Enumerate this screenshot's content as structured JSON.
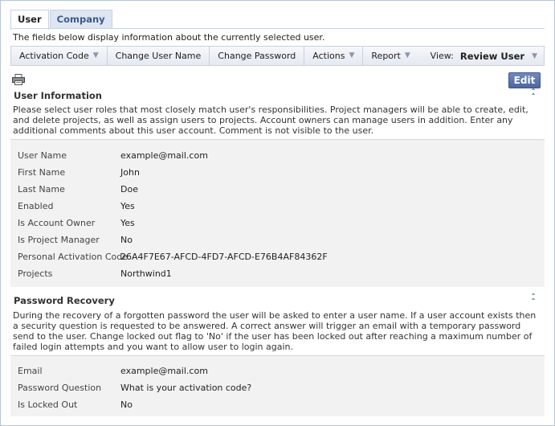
{
  "tabs": [
    {
      "label": "User"
    },
    {
      "label": "Company"
    }
  ],
  "page_description": "The fields below display information about the currently selected user.",
  "toolbar": {
    "activation_code": "Activation Code",
    "change_user_name": "Change User Name",
    "change_password": "Change Password",
    "actions": "Actions",
    "report": "Report",
    "view_label": "View:",
    "view_value": "Review User"
  },
  "edit_label": "Edit",
  "user_info": {
    "title": "User Information",
    "description": "Please select user roles that most closely match user's responsibilities. Project managers will be able to create, edit, and delete projects, as well as assign users to projects. Account owners can manage users in addition. Enter any additional comments about this user account. Comment is not visible to the user.",
    "fields": [
      {
        "label": "User Name",
        "value": "example@mail.com"
      },
      {
        "label": "First Name",
        "value": "John"
      },
      {
        "label": "Last Name",
        "value": "Doe"
      },
      {
        "label": "Enabled",
        "value": "Yes"
      },
      {
        "label": "Is Account Owner",
        "value": "Yes"
      },
      {
        "label": "Is Project Manager",
        "value": "No"
      },
      {
        "label": "Personal Activation Code",
        "value": "26A4F7E67-AFCD-4FD7-AFCD-E76B4AF84362F"
      },
      {
        "label": "Projects",
        "value": "Northwind1"
      }
    ]
  },
  "password_recovery": {
    "title": "Password Recovery",
    "description": "During the recovery of a forgotten password the user will be asked to enter a user name. If a user account exists then a security question is requested to be answered. A correct answer will trigger an email with a temporary password send to the user. Change locked out flag to 'No' if the user has been locked out after reaching a maximum number of failed login attempts and you want to allow user to login again.",
    "fields": [
      {
        "label": "Email",
        "value": "example@mail.com"
      },
      {
        "label": "Password Question",
        "value": "What is your activation code?"
      },
      {
        "label": "Is Locked Out",
        "value": "No"
      }
    ]
  }
}
